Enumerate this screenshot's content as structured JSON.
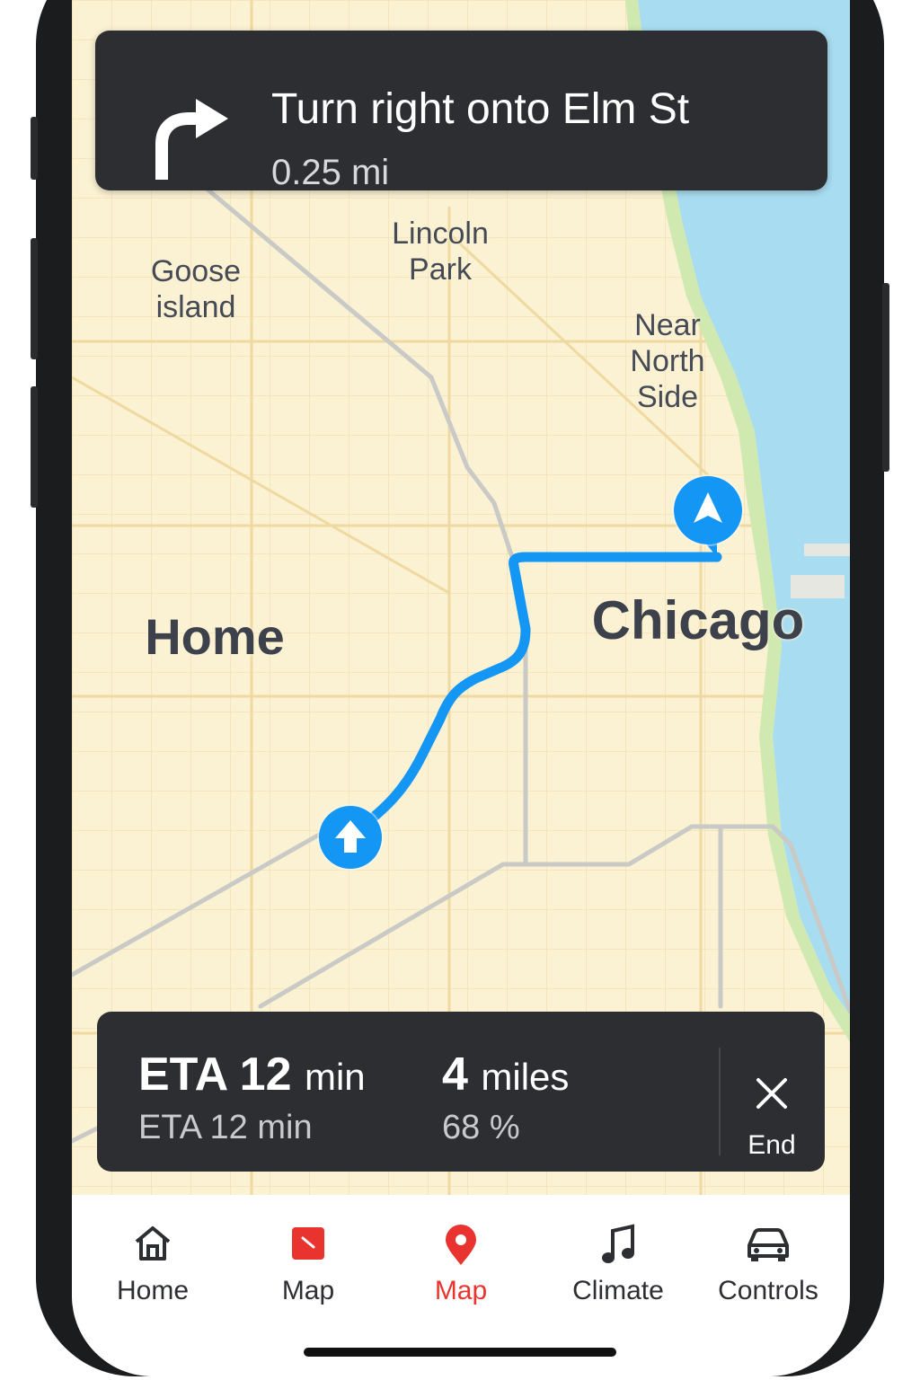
{
  "navigation": {
    "instruction": "Turn right onto Elm St",
    "distance": "0.25 mi",
    "maneuver_icon": "turn-right-icon"
  },
  "map": {
    "labels": {
      "goose_island": "Goose\nisland",
      "lincoln_park": "Lincoln\nPark",
      "near_north_side": "Near\nNorth\nSide",
      "home": "Home",
      "chicago": "Chicago"
    },
    "route_color": "#1496f5",
    "land_color": "#fbf1d3",
    "water_color": "#a8dcf0",
    "park_color": "#cfe9b0"
  },
  "trip": {
    "eta_label": "ETA 12",
    "eta_unit": "min",
    "eta_secondary": "ETA 12 min",
    "distance_value": "4",
    "distance_unit": "miles",
    "battery": "68 %",
    "end_label": "End"
  },
  "tabs": [
    {
      "label": "Home",
      "icon": "home-icon",
      "active": false
    },
    {
      "label": "Map",
      "icon": "map-tile-icon",
      "active": false
    },
    {
      "label": "Map",
      "icon": "location-pin-icon",
      "active": true
    },
    {
      "label": "Climate",
      "icon": "music-note-icon",
      "active": false
    },
    {
      "label": "Controls",
      "icon": "car-icon",
      "active": false
    }
  ],
  "colors": {
    "accent_red": "#e8332e",
    "panel": "#2c2e31"
  }
}
